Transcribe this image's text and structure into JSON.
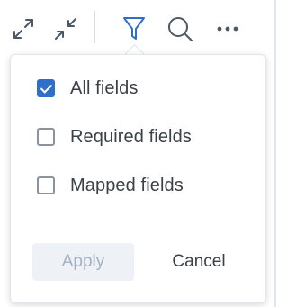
{
  "toolbar": {
    "icons": [
      "expand-icon",
      "collapse-icon",
      "filter-icon",
      "search-icon",
      "more-icon"
    ],
    "active_color": "#2f6fca",
    "icon_color": "#4d5865"
  },
  "filter_menu": {
    "options": [
      {
        "label": "All fields",
        "checked": true
      },
      {
        "label": "Required fields",
        "checked": false
      },
      {
        "label": "Mapped fields",
        "checked": false
      }
    ],
    "apply_label": "Apply",
    "cancel_label": "Cancel"
  }
}
